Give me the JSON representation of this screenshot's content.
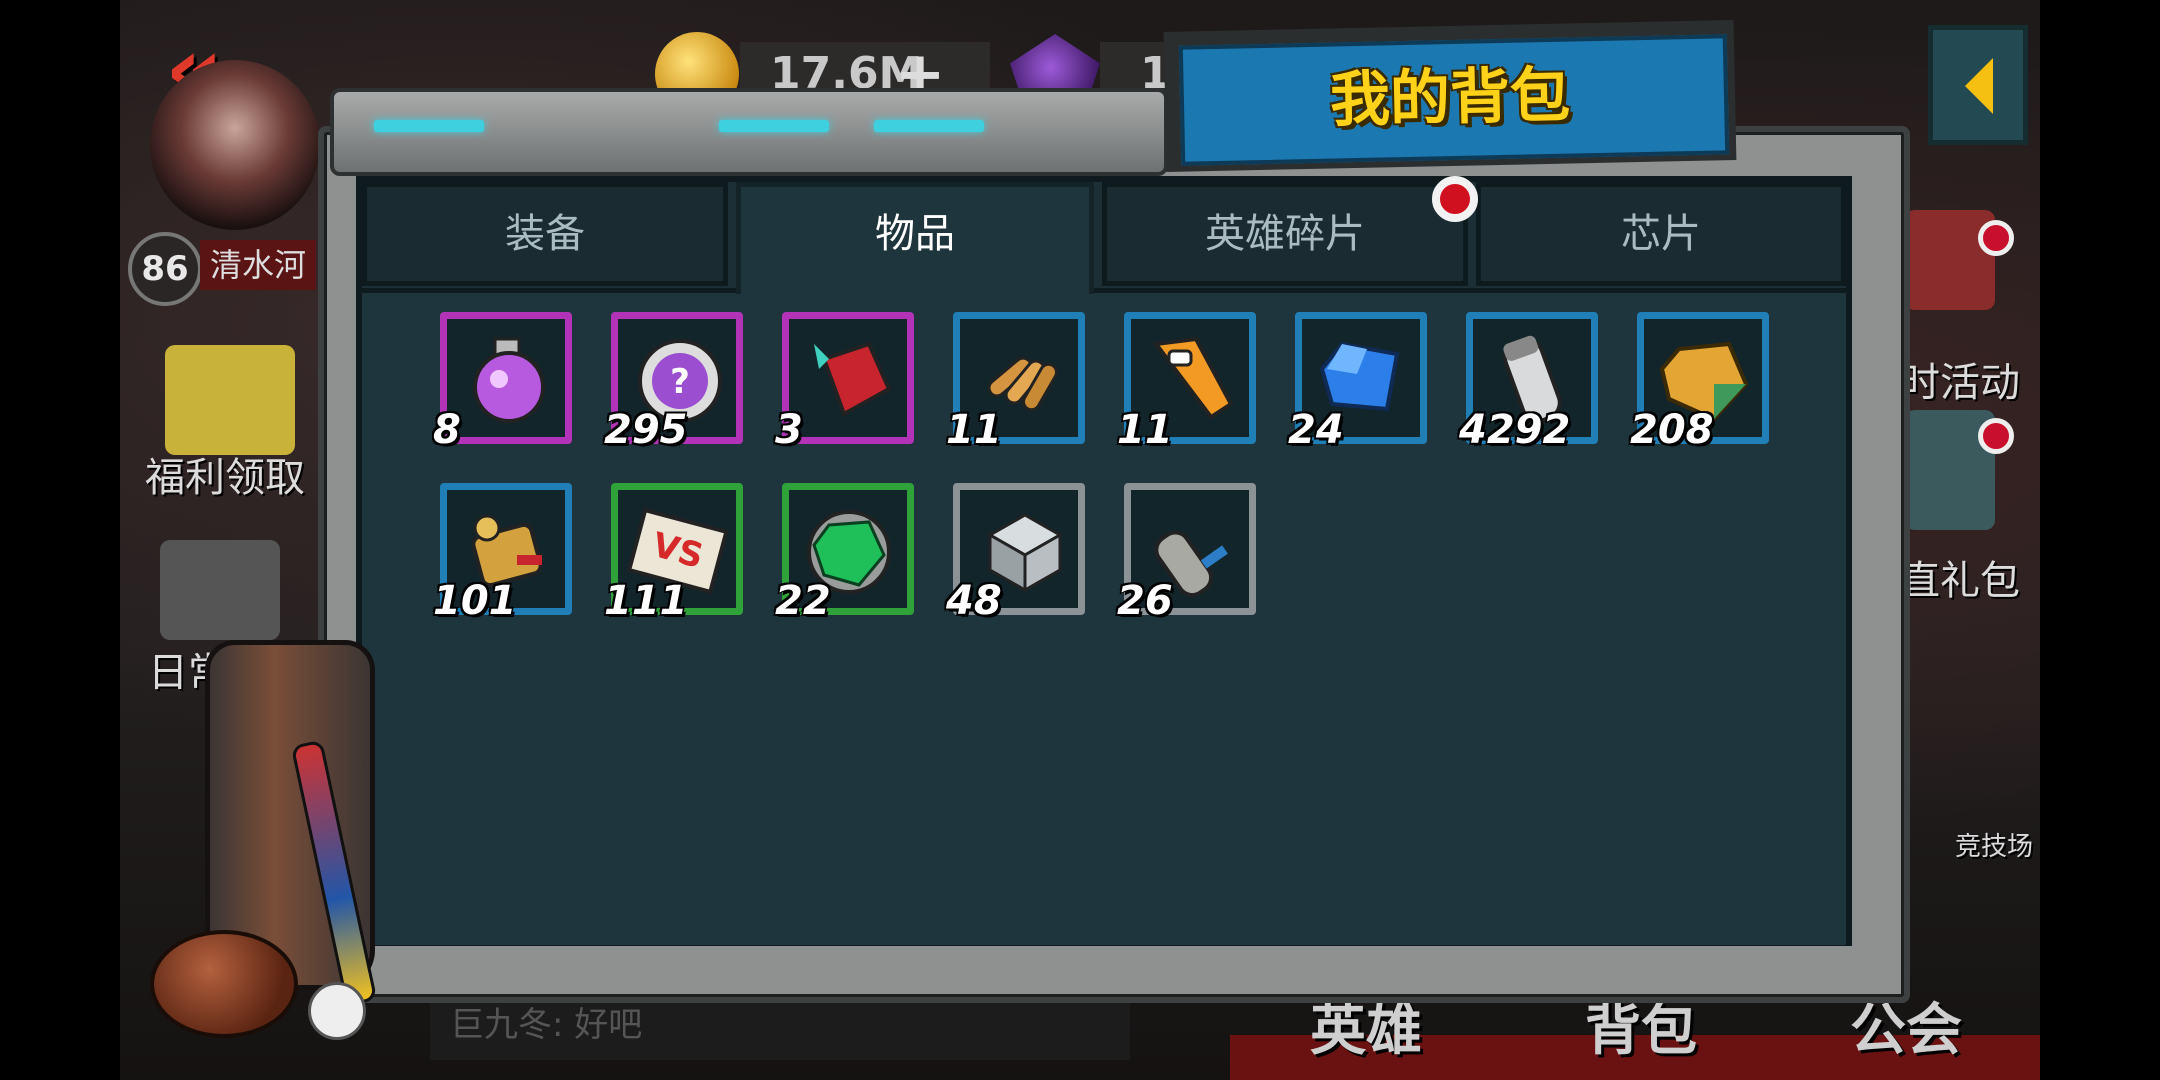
{
  "title": "我的背包",
  "tabs": [
    {
      "label": "装备",
      "active": false
    },
    {
      "label": "物品",
      "active": true
    },
    {
      "label": "英雄碎片",
      "active": false,
      "badge": true
    },
    {
      "label": "芯片",
      "active": false
    }
  ],
  "items": [
    {
      "name": "purple-potion",
      "count": "8",
      "rarity": "purple"
    },
    {
      "name": "question-chip",
      "count": "295",
      "rarity": "purple"
    },
    {
      "name": "red-scroll",
      "count": "3",
      "rarity": "purple"
    },
    {
      "name": "bullets",
      "count": "11",
      "rarity": "blue"
    },
    {
      "name": "bottle-opener",
      "count": "11",
      "rarity": "blue"
    },
    {
      "name": "blue-crystal",
      "count": "24",
      "rarity": "blue"
    },
    {
      "name": "silver-vial",
      "count": "4292",
      "rarity": "blue"
    },
    {
      "name": "amber-gem",
      "count": "208",
      "rarity": "blue"
    },
    {
      "name": "gold-scroll",
      "count": "101",
      "rarity": "blue"
    },
    {
      "name": "vs-ticket",
      "count": "111",
      "rarity": "green"
    },
    {
      "name": "green-gem",
      "count": "22",
      "rarity": "green"
    },
    {
      "name": "metal-cube",
      "count": "48",
      "rarity": "grey"
    },
    {
      "name": "grey-scroll",
      "count": "26",
      "rarity": "grey"
    }
  ],
  "background": {
    "player_level": "86",
    "player_name": "清水河",
    "gold": "17.6M",
    "gems": "1",
    "left_labels": [
      "福利领取",
      "日常任"
    ],
    "right_labels": [
      "时活动",
      "直礼包",
      "竞技场"
    ],
    "chat": "巨九冬: 好吧",
    "bottom_nav": [
      "英雄",
      "背包",
      "公会"
    ]
  },
  "colors": {
    "purple": "#b233b8",
    "blue": "#1f7fb6",
    "green": "#2fa33a",
    "grey": "#8c9396",
    "title_text": "#ffd21a",
    "title_plate": "#1c78b0"
  }
}
